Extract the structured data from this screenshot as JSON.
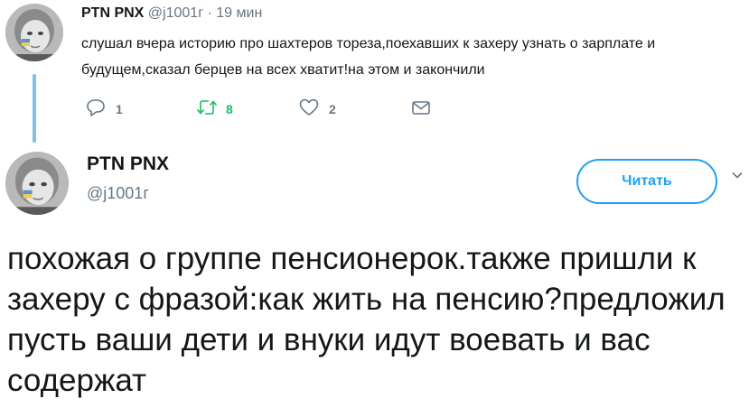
{
  "parent_tweet": {
    "name": "PTN PNX",
    "handle": "@j1001г",
    "separator": "·",
    "time": "19 мин",
    "text": "слушал вчера историю про шахтеров тореза,поехавших к захеру узнать о зарплате и будущем,сказал берцев на всех хватит!на этом и закончили",
    "actions": {
      "reply_count": "1",
      "retweet_count": "8",
      "like_count": "2",
      "reply_icon": "reply-icon",
      "retweet_icon": "retweet-icon",
      "like_icon": "heart-icon",
      "dm_icon": "envelope-icon"
    }
  },
  "main_tweet": {
    "name": "PTN PNX",
    "handle": "@j1001г",
    "follow_label": "Читать",
    "caret_icon": "chevron-down-icon",
    "text": "похожая о группе пенсионерок.также пришли к захеру с фразой:как жить на пенсию?предложил пусть ваши дети и внуки идут воевать и вас содержат"
  },
  "colors": {
    "accent": "#1da1f2",
    "retweet_green": "#17bf63",
    "muted": "#657786",
    "thread_line": "#7fc0e5",
    "text": "#14171a"
  }
}
